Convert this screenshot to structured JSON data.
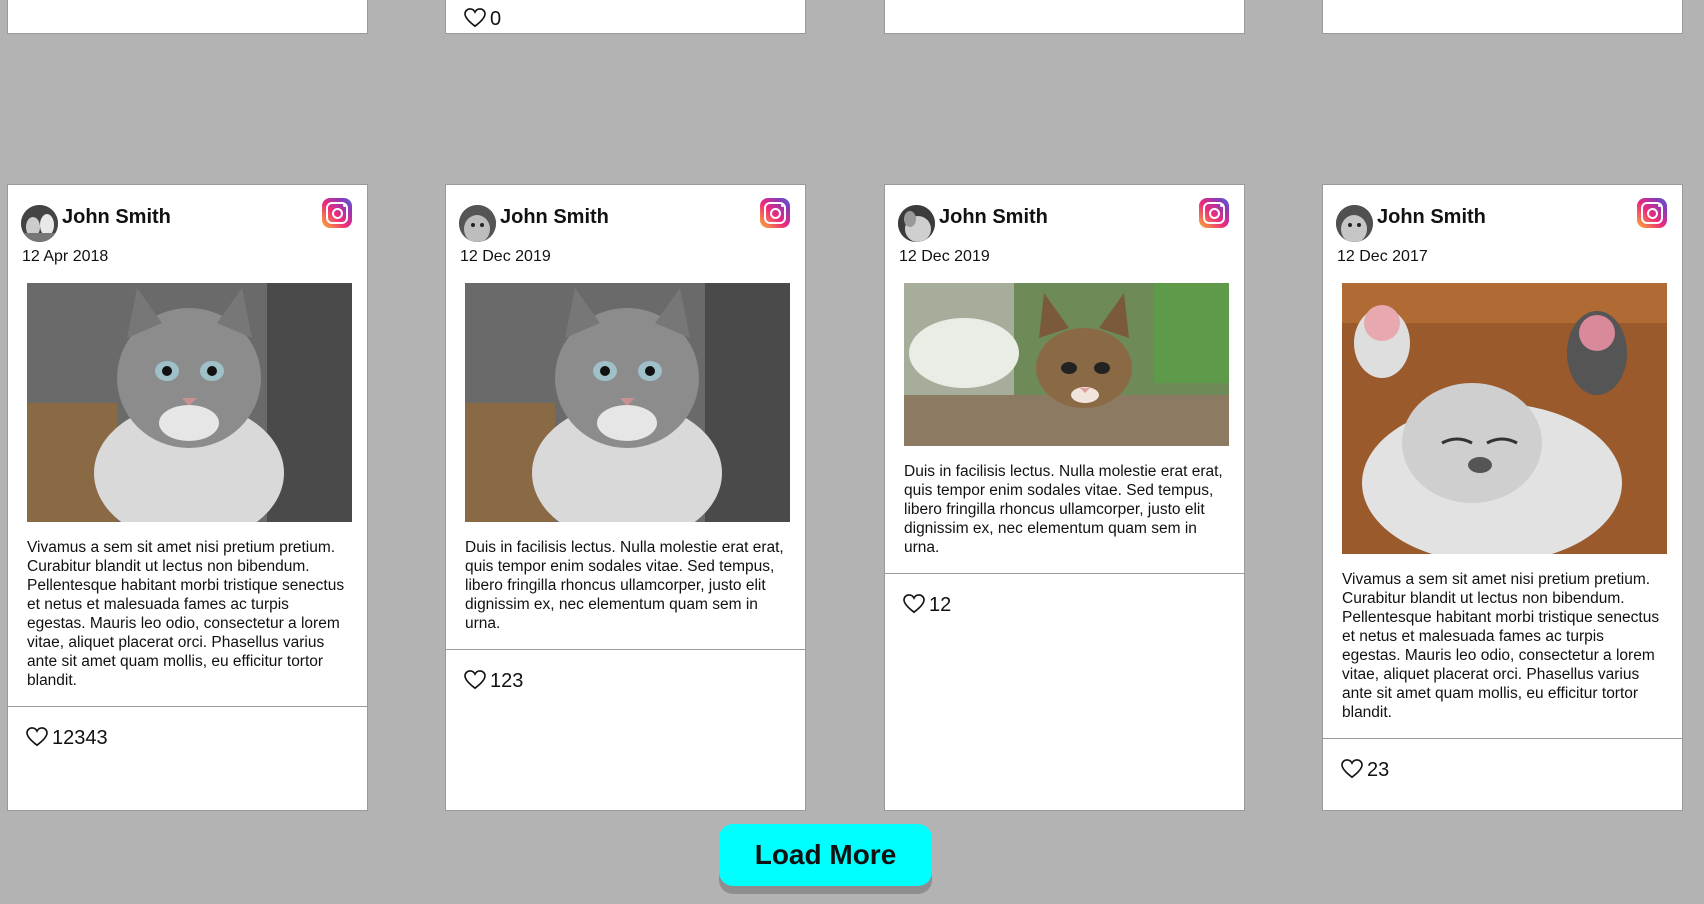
{
  "partial_cards": [
    {
      "likes": ""
    },
    {
      "likes": "0"
    },
    {
      "likes": ""
    },
    {
      "likes": ""
    }
  ],
  "posts": [
    {
      "author": "John Smith",
      "date": "12 Apr 2018",
      "image": "kitten-portrait",
      "text": "Vivamus a sem sit amet nisi pretium pretium. Curabitur blandit ut lectus non bibendum. Pellentesque habitant morbi tristique senectus et netus et malesuada fames ac turpis egestas. Mauris leo odio, consectetur a lorem vitae, aliquet placerat orci. Phasellus varius ante sit amet quam mollis, eu efficitur tortor blandit.",
      "likes": "12343"
    },
    {
      "author": "John Smith",
      "date": "12 Dec 2019",
      "image": "kitten-portrait",
      "text": "Duis in facilisis lectus. Nulla molestie erat erat, quis tempor enim sodales vitae. Sed tempus, libero fringilla rhoncus ullamcorper, justo elit dignissim ex, nec elementum quam sem in urna.",
      "likes": "123"
    },
    {
      "author": "John Smith",
      "date": "12 Dec 2019",
      "image": "kitten-table",
      "text": "Duis in facilisis lectus. Nulla molestie erat erat, quis tempor enim sodales vitae. Sed tempus, libero fringilla rhoncus ullamcorper, justo elit dignissim ex, nec elementum quam sem in urna.",
      "likes": "12"
    },
    {
      "author": "John Smith",
      "date": "12 Dec 2017",
      "image": "kitten-sleeping",
      "text": "Vivamus a sem sit amet nisi pretium pretium. Curabitur blandit ut lectus non bibendum. Pellentesque habitant morbi tristique senectus et netus et malesuada fames ac turpis egestas. Mauris leo odio, consectetur a lorem vitae, aliquet placerat orci. Phasellus varius ante sit amet quam mollis, eu efficitur tortor blandit.",
      "likes": "23"
    }
  ],
  "load_more_label": "Load More",
  "colors": {
    "page_background": "#b3b3b3",
    "card_background": "#ffffff",
    "button_background": "#00ffff"
  }
}
